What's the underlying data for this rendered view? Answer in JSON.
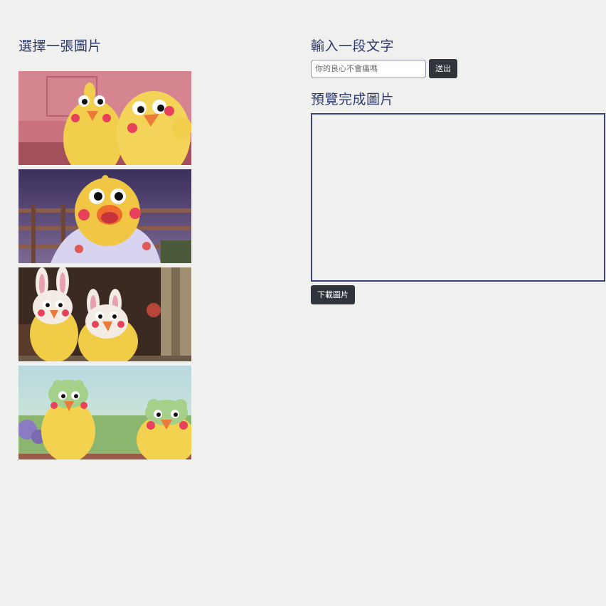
{
  "left": {
    "heading": "選擇一張圖片"
  },
  "gallery": [
    {
      "name": "image-1",
      "scene": "two-chicks-pink-room"
    },
    {
      "name": "image-2",
      "scene": "chick-shouting-dusk"
    },
    {
      "name": "image-3",
      "scene": "bunny-costume-chicks"
    },
    {
      "name": "image-4",
      "scene": "frog-costume-chicks"
    }
  ],
  "right": {
    "heading": "輸入一段文字",
    "input_value": "",
    "input_placeholder": "你的良心不會痛嗎",
    "send_label": "送出",
    "preview_heading": "預覽完成圖片",
    "download_label": "下載圖片"
  },
  "colors": {
    "background": "#f0f0ee",
    "heading": "#2e3a6e",
    "button": "#30343b",
    "canvas_border": "#3a4281"
  }
}
